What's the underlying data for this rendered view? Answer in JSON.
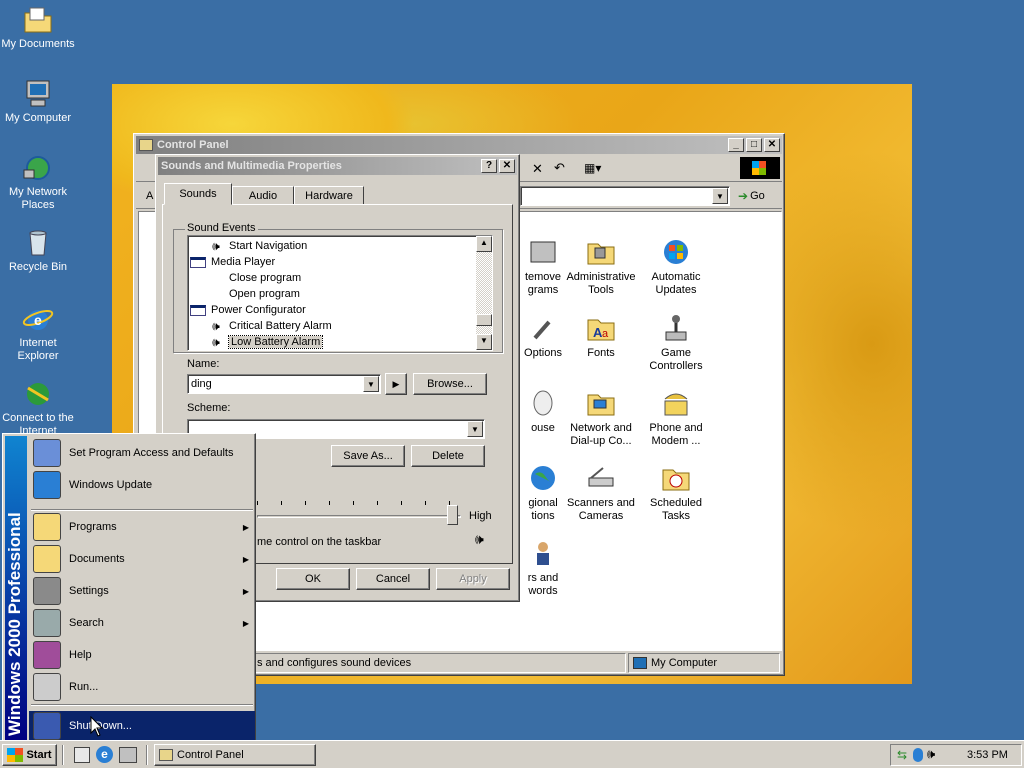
{
  "desktop": {
    "icons": [
      {
        "label": "My Documents",
        "icon": "folder-documents-icon"
      },
      {
        "label": "My Computer",
        "icon": "computer-icon"
      },
      {
        "label": "My Network Places",
        "icon": "network-icon"
      },
      {
        "label": "Recycle Bin",
        "icon": "recycle-bin-icon"
      },
      {
        "label": "Internet Explorer",
        "icon": "ie-icon"
      },
      {
        "label": "Connect to the Internet",
        "icon": "connect-icon"
      }
    ]
  },
  "control_panel": {
    "title": "Control Panel",
    "address_label": "A",
    "go_label": "Go",
    "status_text": "s and configures sound devices",
    "status_location": "My Computer",
    "items": [
      {
        "label": "temove\ngrams",
        "icon": "add-remove-icon"
      },
      {
        "label": "Administrative Tools",
        "icon": "admin-tools-icon"
      },
      {
        "label": "Automatic Updates",
        "icon": "windows-update-icon"
      },
      {
        "label": "Options",
        "icon": "options-icon"
      },
      {
        "label": "Fonts",
        "icon": "fonts-icon"
      },
      {
        "label": "Game Controllers",
        "icon": "joystick-icon"
      },
      {
        "label": "ouse",
        "icon": "mouse-icon"
      },
      {
        "label": "Network and Dial-up Co...",
        "icon": "network-folder-icon"
      },
      {
        "label": "Phone and Modem ...",
        "icon": "phone-icon"
      },
      {
        "label": "gional\ntions",
        "icon": "globe-icon"
      },
      {
        "label": "Scanners and Cameras",
        "icon": "scanner-icon"
      },
      {
        "label": "Scheduled Tasks",
        "icon": "scheduled-tasks-icon"
      },
      {
        "label": "rs and\nwords",
        "icon": "users-icon"
      }
    ]
  },
  "sounds_dialog": {
    "title": "Sounds and Multimedia Properties",
    "help_btn": "?",
    "close_btn": "✕",
    "tabs": [
      "Sounds",
      "Audio",
      "Hardware"
    ],
    "active_tab": "Sounds",
    "sound_events_label": "Sound Events",
    "events": [
      {
        "label": "Start Navigation",
        "indent": 2,
        "has_sound": true
      },
      {
        "label": "Media Player",
        "indent": 1,
        "has_sound": false,
        "group": true
      },
      {
        "label": "Close program",
        "indent": 2,
        "has_sound": false
      },
      {
        "label": "Open program",
        "indent": 2,
        "has_sound": false
      },
      {
        "label": "Power Configurator",
        "indent": 1,
        "has_sound": false,
        "group": true
      },
      {
        "label": "Critical Battery Alarm",
        "indent": 2,
        "has_sound": true
      },
      {
        "label": "Low Battery Alarm",
        "indent": 2,
        "has_sound": true,
        "selected": true
      }
    ],
    "name_label": "Name:",
    "name_value": "ding",
    "browse_btn": "Browse...",
    "scheme_label": "Scheme:",
    "scheme_value": "",
    "save_as_btn": "Save As...",
    "delete_btn": "Delete",
    "volume_high": "High",
    "volume_taskbar_text": "me control on the taskbar",
    "ok_btn": "OK",
    "cancel_btn": "Cancel",
    "apply_btn": "Apply"
  },
  "start_menu": {
    "banner": "Windows 2000 Professional",
    "items": [
      {
        "label": "Set Program Access and Defaults",
        "icon": "program-access-icon",
        "submenu": false
      },
      {
        "label": "Windows Update",
        "icon": "windows-update-icon",
        "submenu": false
      },
      {
        "label": "Programs",
        "icon": "programs-icon",
        "submenu": true
      },
      {
        "label": "Documents",
        "icon": "documents-icon",
        "submenu": true
      },
      {
        "label": "Settings",
        "icon": "settings-icon",
        "submenu": true
      },
      {
        "label": "Search",
        "icon": "search-icon",
        "submenu": true
      },
      {
        "label": "Help",
        "icon": "help-icon",
        "submenu": false
      },
      {
        "label": "Run...",
        "icon": "run-icon",
        "submenu": false
      },
      {
        "label": "Shut Down...",
        "icon": "shutdown-icon",
        "submenu": false,
        "highlighted": true
      }
    ]
  },
  "taskbar": {
    "start_label": "Start",
    "tasks": [
      {
        "label": "Control Panel",
        "icon": "control-panel-icon"
      }
    ],
    "clock": "3:53 PM"
  }
}
